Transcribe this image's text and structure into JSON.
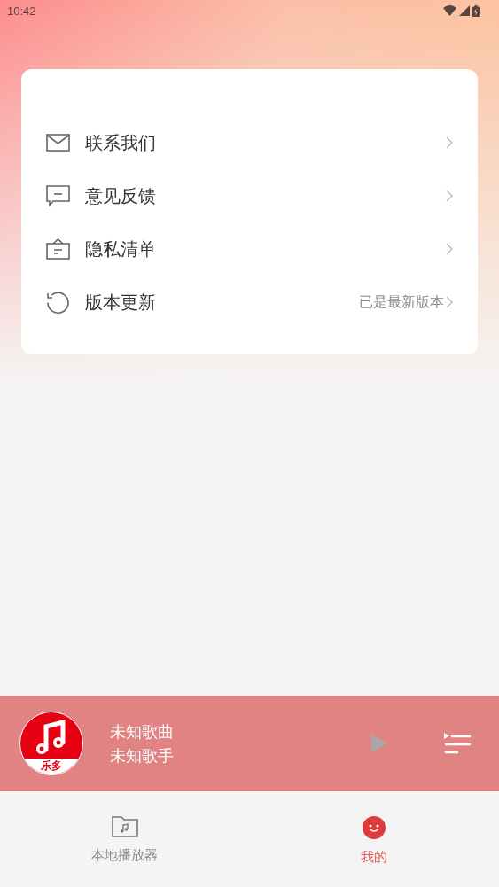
{
  "status_bar": {
    "time": "10:42"
  },
  "menu": [
    {
      "kind": "mail",
      "label": "联系我们"
    },
    {
      "kind": "feedback",
      "label": "意见反馈"
    },
    {
      "kind": "privacy",
      "label": "隐私清单"
    },
    {
      "kind": "update",
      "label": "版本更新",
      "value": "已是最新版本"
    }
  ],
  "player": {
    "logo_text": "乐多",
    "title": "未知歌曲",
    "artist": "未知歌手"
  },
  "tabs": [
    {
      "kind": "folder",
      "label": "本地播放器",
      "selected": false
    },
    {
      "kind": "face",
      "label": "我的",
      "selected": true
    }
  ]
}
